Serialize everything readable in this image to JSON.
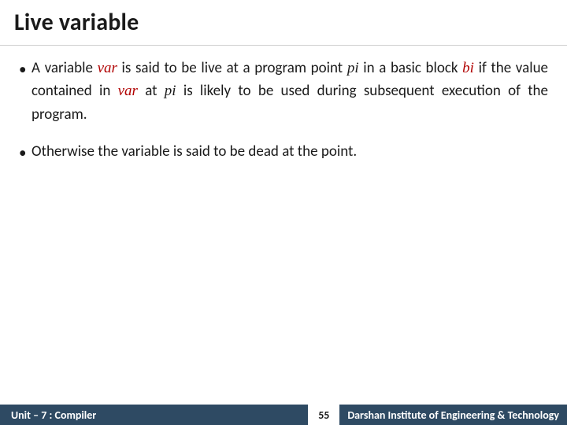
{
  "title": "Live variable",
  "bullets": {
    "b1": {
      "pre": "A variable ",
      "var": "var",
      "mid1": " is said to be live at a program point ",
      "pi1": "pi",
      "mid2": " in a basic block ",
      "bi": "bi",
      "mid3": " if the value contained in ",
      "var2": "var",
      "mid4": " at ",
      "pi2": "pi",
      "tail": " is likely to be used during subsequent execution of the program."
    },
    "b2": "Otherwise the variable is said to be dead at the point."
  },
  "footer": {
    "unit": "Unit – 7 : Compiler",
    "page": "55",
    "inst": "Darshan Institute of Engineering & Technology"
  }
}
